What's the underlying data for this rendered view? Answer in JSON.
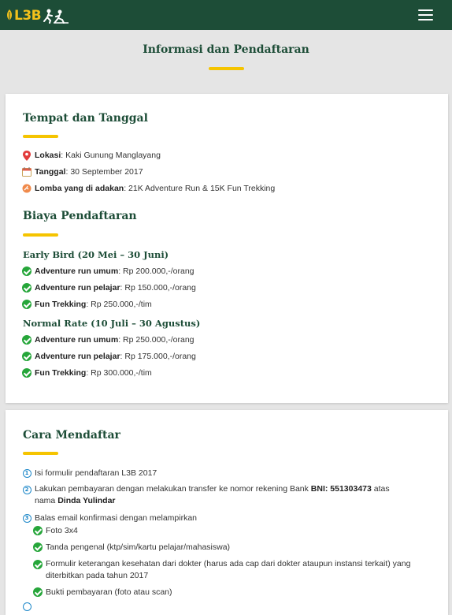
{
  "nav": {
    "logo_text": "L3B",
    "menu_icon": "hamburger-menu-icon"
  },
  "page": {
    "title": "Informasi dan Pendaftaran"
  },
  "tempat": {
    "heading": "Tempat dan Tanggal",
    "items": [
      {
        "icon": "map-pin-icon",
        "label": "Lokasi",
        "value": " : Kaki Gunung Manglayang"
      },
      {
        "icon": "calendar-icon",
        "label": "Tanggal",
        "value": " : 30 September 2017"
      },
      {
        "icon": "running-icon",
        "label": "Lomba yang di adakan",
        "value": " : 21K Adventure Run & 15K Fun Trekking"
      }
    ]
  },
  "biaya": {
    "heading": "Biaya Pendaftaran",
    "early": {
      "title": "Early Bird (20 Mei – 30 Juni)",
      "items": [
        {
          "label": "Adventure run umum",
          "value": " : Rp 200.000,-/orang"
        },
        {
          "label": "Adventure run pelajar",
          "value": " : Rp 150.000,-/orang"
        },
        {
          "label": "Fun Trekking",
          "value": " : Rp 250.000,-/tim"
        }
      ]
    },
    "normal": {
      "title": "Normal Rate (10 Juli – 30 Agustus)",
      "items": [
        {
          "label": "Adventure run umum",
          "value": " : Rp 250.000,-/orang"
        },
        {
          "label": "Adventure run pelajar",
          "value": " : Rp 175.000,-/orang"
        },
        {
          "label": "Fun Trekking",
          "value": " : Rp 300.000,-/tim"
        }
      ]
    }
  },
  "cara": {
    "heading": "Cara Mendaftar",
    "steps": [
      {
        "n": "1",
        "text": "Isi formulir pendaftaran L3B 2017"
      },
      {
        "n": "2",
        "pre": "Lakukan pembayaran dengan melakukan transfer ke nomor rekening Bank ",
        "bold1": "BNI: 551303473",
        "mid": " atas nama ",
        "bold2": "Dinda Yulindar"
      },
      {
        "n": "3",
        "text": "Balas email konfirmasi dengan melampirkan"
      }
    ],
    "attachments": [
      "Foto 3x4",
      "Tanda pengenal (ktp/sim/kartu pelajar/mahasiswa)",
      "Formulir keterangan kesehatan dari dokter (harus ada cap dari dokter ataupun instansi terkait) yang diterbitkan pada tahun 2017",
      "Bukti pembayaran (foto atau scan)"
    ]
  },
  "colors": {
    "brand_green": "#1d4d37",
    "accent_yellow": "#f5c400",
    "check_green": "#26a63a",
    "number_blue": "#1e88c9"
  }
}
